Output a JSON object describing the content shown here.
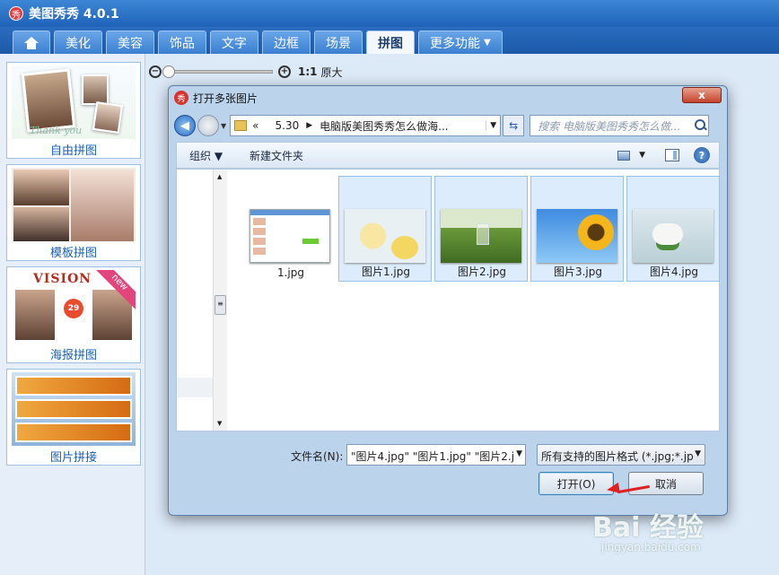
{
  "app": {
    "title": "美图秀秀 4.0.1",
    "logo_glyph": "秀"
  },
  "nav": {
    "tabs": [
      {
        "label": "美化"
      },
      {
        "label": "美容"
      },
      {
        "label": "饰品"
      },
      {
        "label": "文字"
      },
      {
        "label": "边框"
      },
      {
        "label": "场景"
      },
      {
        "label": "拼图",
        "active": true
      },
      {
        "label": "更多功能"
      }
    ]
  },
  "sidebar": {
    "tiles": [
      {
        "label": "自由拼图",
        "thumb_text": "Thank you"
      },
      {
        "label": "模板拼图"
      },
      {
        "label": "海报拼图",
        "thumb_text": "VISION",
        "ribbon": "new",
        "badge": "29"
      },
      {
        "label": "图片拼接"
      }
    ]
  },
  "zoom": {
    "ratio": "1:1",
    "original": "原大",
    "level": 0.0
  },
  "dialog": {
    "title": "打开多张图片",
    "close_label": "x",
    "breadcrumb": {
      "prefix": "«",
      "items": [
        "5.30",
        "电脑版美图秀秀怎么做海..."
      ]
    },
    "search_placeholder": "搜索 电脑版美图秀秀怎么做...",
    "toolbar": {
      "organize": "组织 ▼",
      "new_folder": "新建文件夹"
    },
    "files": [
      {
        "name": "1.jpg",
        "selected": false
      },
      {
        "name": "图片1.jpg",
        "selected": true
      },
      {
        "name": "图片2.jpg",
        "selected": true
      },
      {
        "name": "图片3.jpg",
        "selected": true
      },
      {
        "name": "图片4.jpg",
        "selected": true
      }
    ],
    "filename_label": "文件名(N):",
    "filename_value": "\"图片4.jpg\" \"图片1.jpg\" \"图片2.j",
    "filetype_value": "所有支持的图片格式 (*.jpg;*.jp",
    "open_button": "打开(O)",
    "cancel_button": "取消"
  },
  "watermark": {
    "brand": "Bai 经验",
    "url": "jingyan.baidu.com"
  },
  "colors": {
    "accent": "#1f62b8",
    "selection": "#dcecfc",
    "annotation_arrow": "#e02020"
  }
}
